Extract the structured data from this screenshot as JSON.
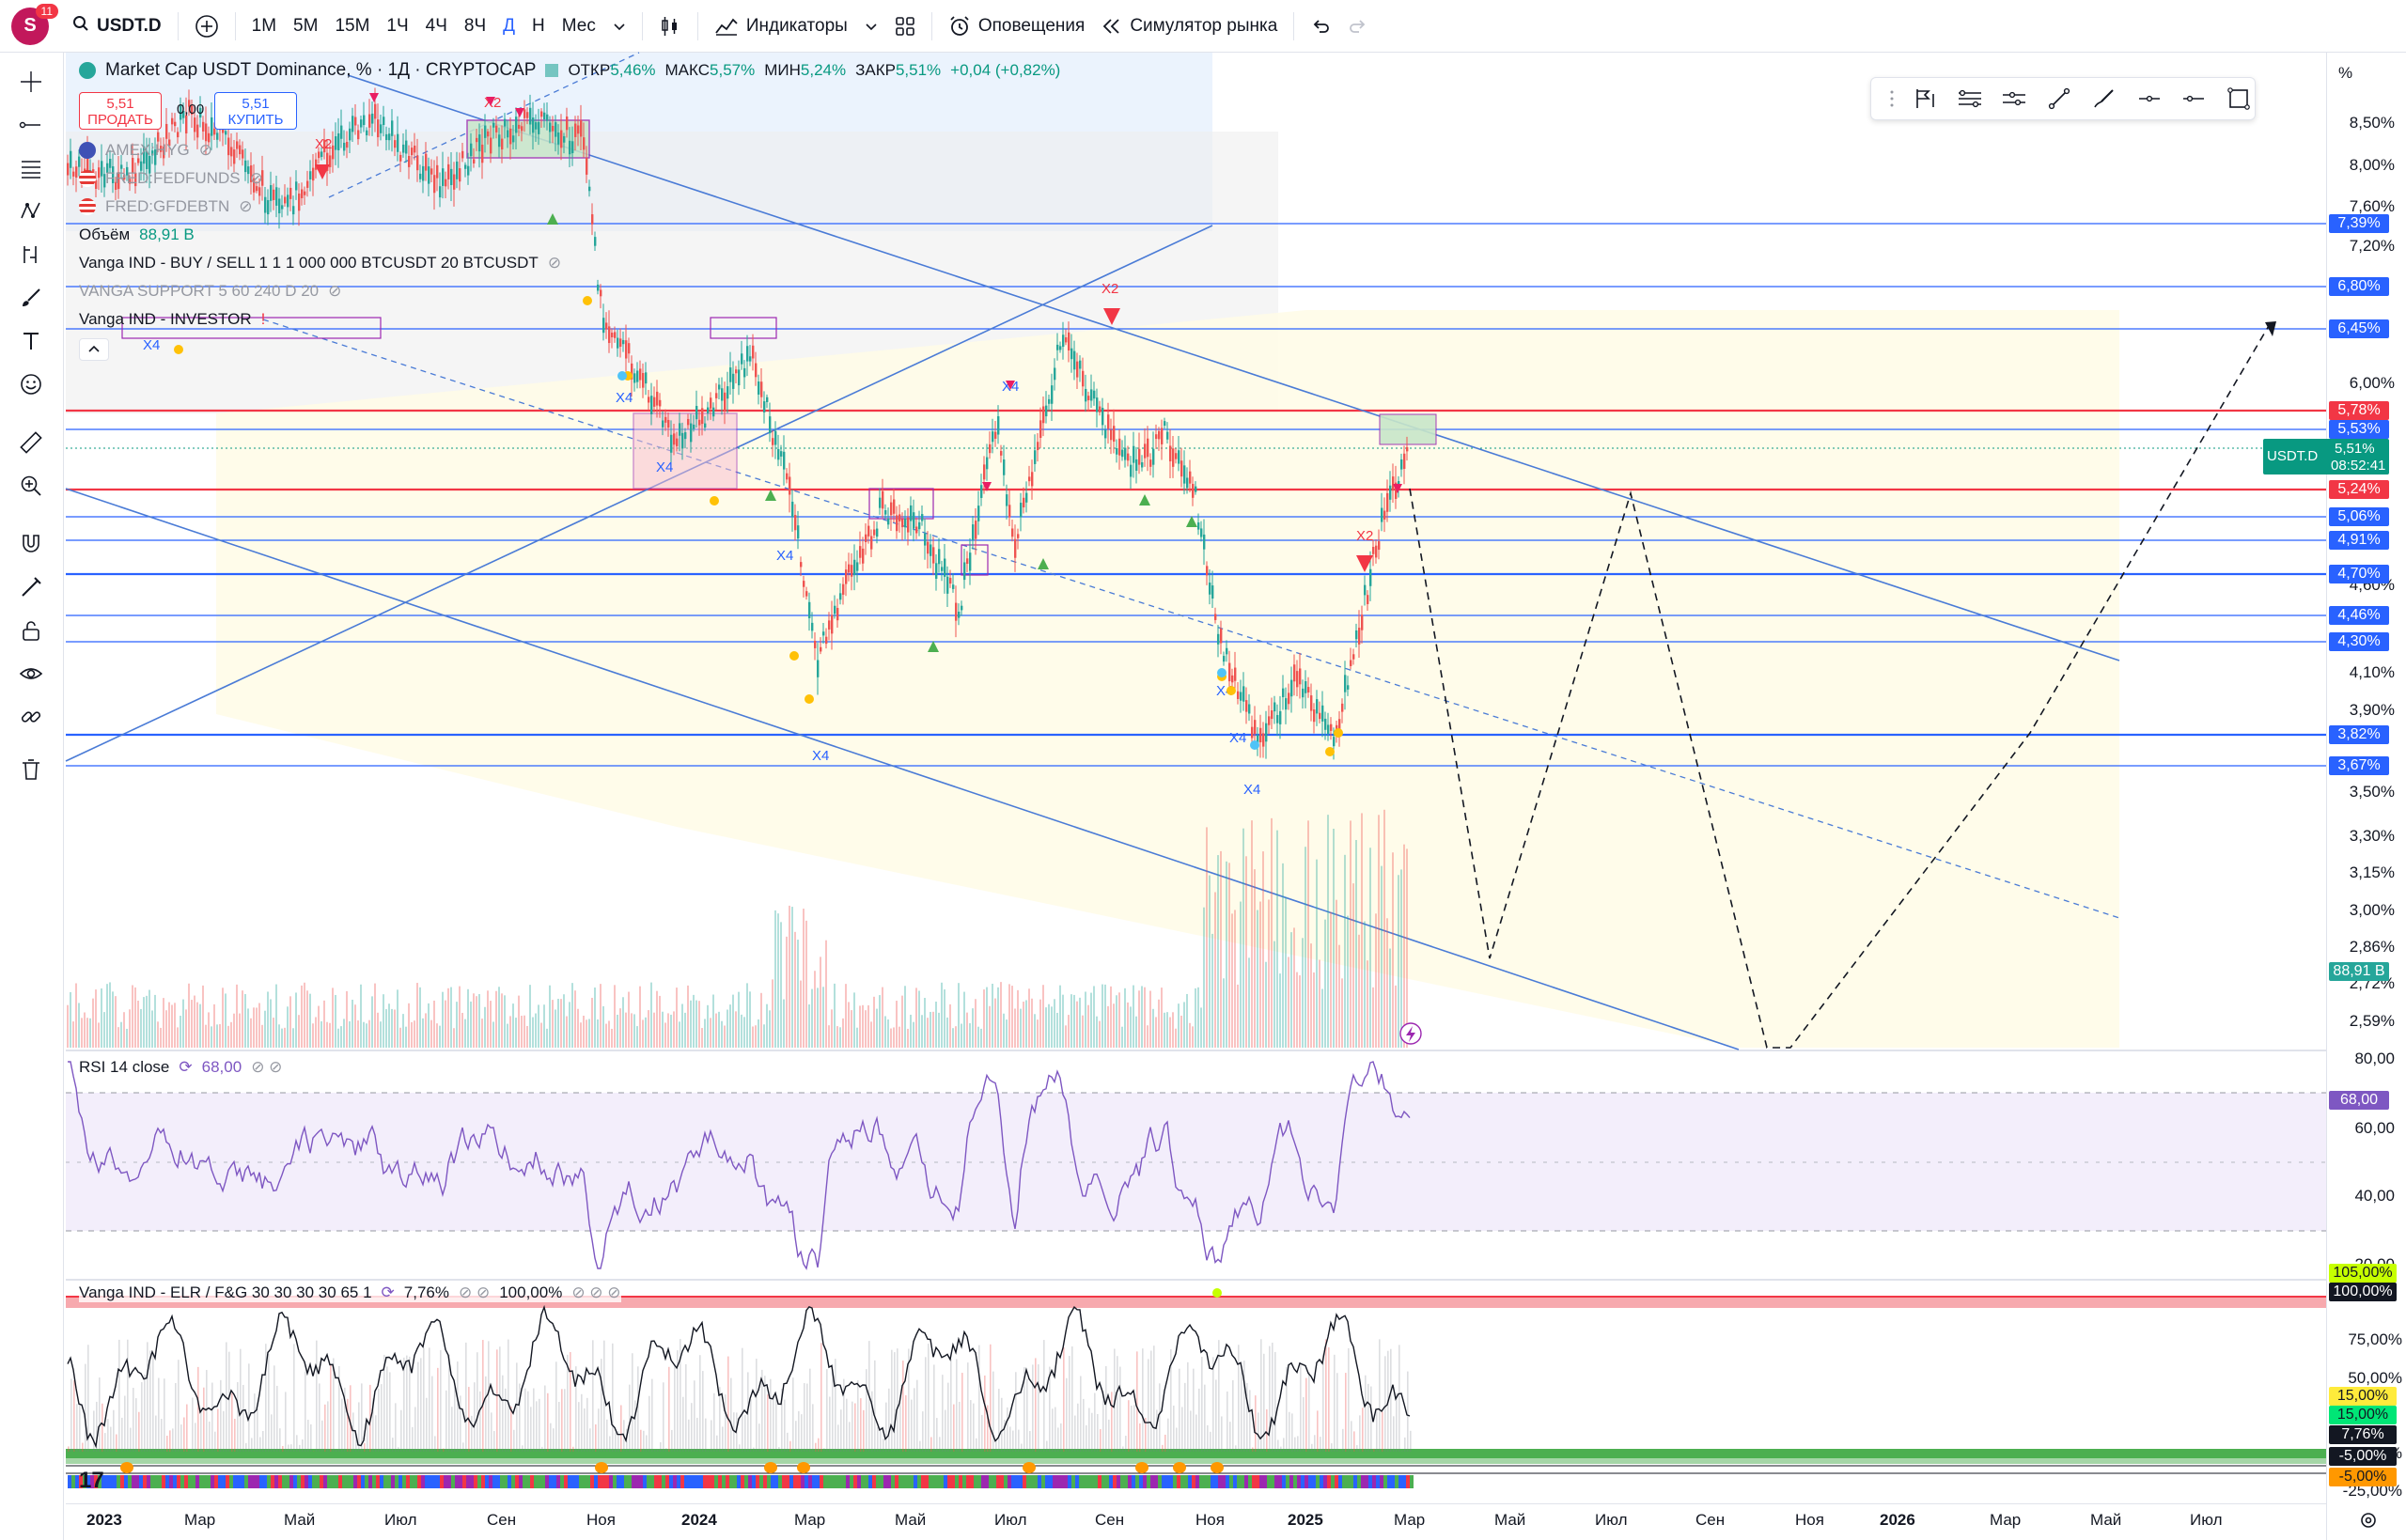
{
  "toolbar": {
    "avatar_letter": "S",
    "notification_count": "11",
    "symbol": "USDT.D",
    "intervals": [
      "1M",
      "5M",
      "15M",
      "1Ч",
      "4Ч",
      "8Ч",
      "Д",
      "Н",
      "Мес"
    ],
    "active_interval": "Д",
    "indicators_label": "Индикаторы",
    "alerts_label": "Оповещения",
    "replay_label": "Симулятор рынка"
  },
  "legend": {
    "title": "Market Cap USDT Dominance, % · 1Д · CRYPTOCAP",
    "open_label": "ОТКР",
    "open_value": "5,46%",
    "high_label": "МАКС",
    "high_value": "5,57%",
    "low_label": "МИН",
    "low_value": "5,24%",
    "close_label": "ЗАКР",
    "close_value": "5,51%",
    "change": "+0,04 (+0,82%)",
    "sell_price": "5,51",
    "sell_label": "ПРОДАТЬ",
    "spread": "0,00",
    "buy_price": "5,51",
    "buy_label": "КУПИТЬ",
    "compare_1": "AMEX:HYG",
    "compare_2": "FRED:FEDFUNDS",
    "compare_3": "FRED:GFDEBTN",
    "volume_label": "Объём",
    "volume_value": "88,91 B",
    "ind_1": "Vanga IND - BUY / SELL  1  1  1 000 000  BTCUSDT  20  BTCUSDT",
    "ind_2": "VANGA SUPPORT  5  60  240  D  20",
    "ind_3": "Vanga IND - INVESTOR"
  },
  "rsi": {
    "label": "RSI 14 close",
    "value": "68,00"
  },
  "elr": {
    "label": "Vanga IND - ELR / F&G 30 30 30 30 65 1",
    "value": "7,76%",
    "value2": "100,00%"
  },
  "price_axis": {
    "unit": "%",
    "ticks": [
      "8,50%",
      "8,00%",
      "7,60%",
      "7,20%",
      "6,00%",
      "4,60%",
      "4,10%",
      "3,90%",
      "3,50%",
      "3,30%",
      "3,15%",
      "3,00%",
      "2,86%",
      "2,72%",
      "2,59%"
    ],
    "rsi_ticks": [
      "80,00",
      "60,00",
      "40,00",
      "20,00"
    ],
    "elr_ticks": [
      "75,00%",
      "50,00%",
      "25,00%",
      "-25,00%"
    ],
    "badges": [
      {
        "text": "7,39%",
        "color": "#2962ff"
      },
      {
        "text": "6,80%",
        "color": "#2962ff"
      },
      {
        "text": "6,45%",
        "color": "#2962ff"
      },
      {
        "text": "5,78%",
        "color": "#f23645"
      },
      {
        "text": "5,53%",
        "color": "#2962ff"
      },
      {
        "text": "5,24%",
        "color": "#f23645"
      },
      {
        "text": "5,06%",
        "color": "#2962ff"
      },
      {
        "text": "4,91%",
        "color": "#2962ff"
      },
      {
        "text": "4,70%",
        "color": "#2962ff"
      },
      {
        "text": "4,46%",
        "color": "#2962ff"
      },
      {
        "text": "4,30%",
        "color": "#2962ff"
      },
      {
        "text": "3,82%",
        "color": "#2962ff"
      },
      {
        "text": "3,67%",
        "color": "#2962ff"
      }
    ],
    "symbol_badge": "USDT.D",
    "last_price": "5,51%",
    "countdown": "08:52:41",
    "volume_badge": "88,91 B",
    "rsi_badge": "68,00",
    "elr_badges": [
      "105,00%",
      "100,00%",
      "15,00%",
      "15,00%",
      "7,76%",
      "-5,00%",
      "-5,00%"
    ]
  },
  "time_axis": [
    "2023",
    "Мар",
    "Май",
    "Июл",
    "Сен",
    "Ноя",
    "2024",
    "Мар",
    "Май",
    "Июл",
    "Сен",
    "Ноя",
    "2025",
    "Мар",
    "Май",
    "Июл",
    "Сен",
    "Ноя",
    "2026",
    "Мар",
    "Май",
    "Июл"
  ],
  "markers": {
    "x2": "X2",
    "x4": "X4"
  }
}
